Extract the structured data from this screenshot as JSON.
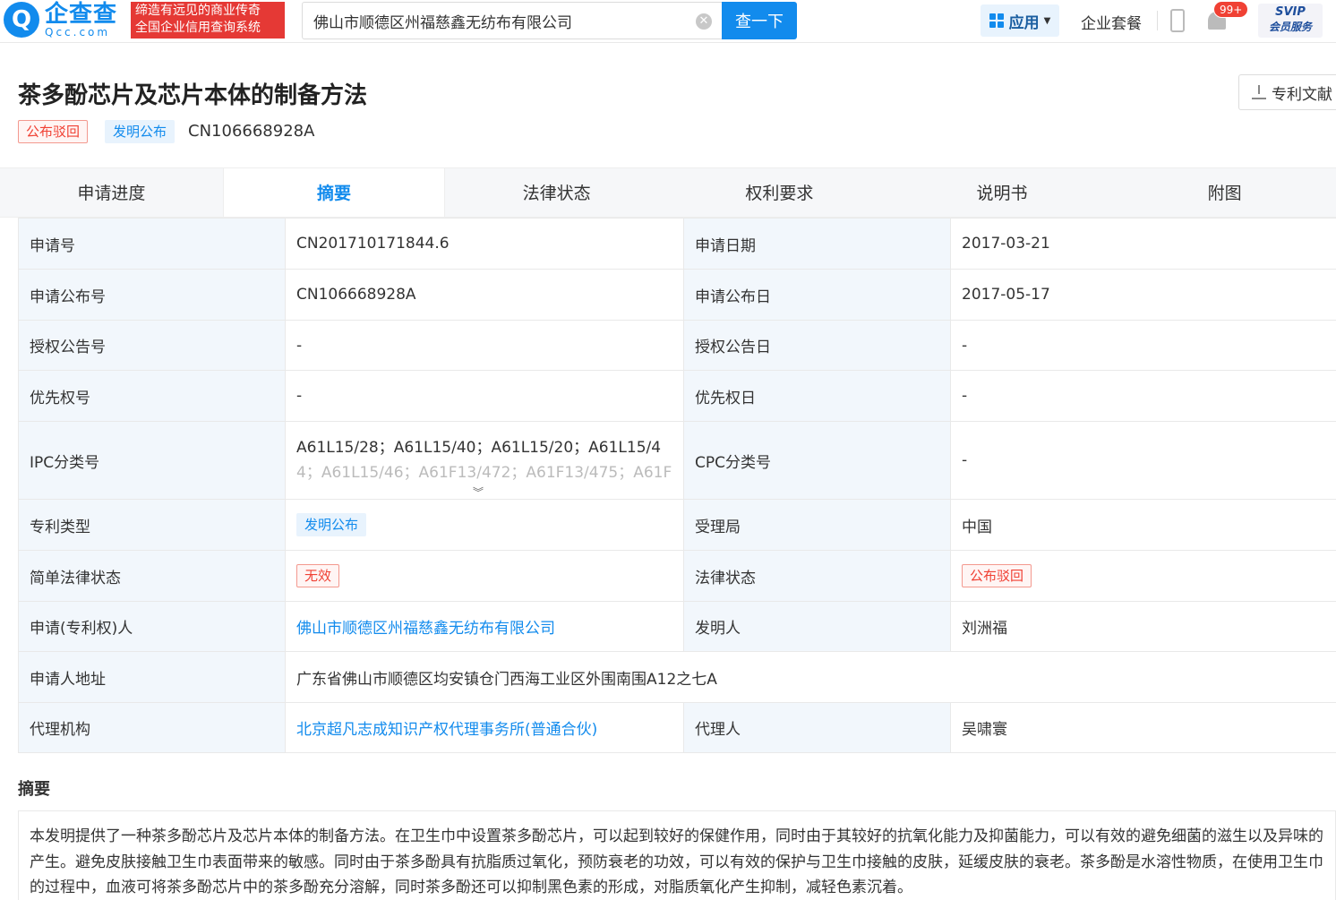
{
  "header": {
    "logo_mark": "Q",
    "logo_name": "企查查",
    "logo_domain": "Qcc.com",
    "slogan_line1": "缔造有远见的商业传奇",
    "slogan_line2": "全国企业信用查询系统",
    "search_value": "佛山市顺德区州福慈鑫无纺布有限公司",
    "search_button": "查一下",
    "apps_label": "应用",
    "package_label": "企业套餐",
    "notification_count": "99+",
    "svip_label": "SVIP",
    "svip_sub": "会员服务"
  },
  "patent": {
    "title": "茶多酚芯片及芯片本体的制备方法",
    "status_tag": "公布驳回",
    "type_tag": "发明公布",
    "number": "CN106668928A",
    "download_label": "专利文献"
  },
  "tabs": [
    "申请进度",
    "摘要",
    "法律状态",
    "权利要求",
    "说明书",
    "附图"
  ],
  "active_tab": "摘要",
  "details": {
    "app_no_label": "申请号",
    "app_no": "CN201710171844.6",
    "app_date_label": "申请日期",
    "app_date": "2017-03-21",
    "pub_no_label": "申请公布号",
    "pub_no": "CN106668928A",
    "pub_date_label": "申请公布日",
    "pub_date": "2017-05-17",
    "grant_no_label": "授权公告号",
    "grant_no": "-",
    "grant_date_label": "授权公告日",
    "grant_date": "-",
    "priority_no_label": "优先权号",
    "priority_no": "-",
    "priority_date_label": "优先权日",
    "priority_date": "-",
    "ipc_label": "IPC分类号",
    "ipc_line1": "A61L15/28；A61L15/40；A61L15/20；A61L15/4",
    "ipc_line2": "4；A61L15/46；A61F13/472；A61F13/475；A61F",
    "cpc_label": "CPC分类号",
    "cpc": "-",
    "patent_type_label": "专利类型",
    "patent_type": "发明公布",
    "office_label": "受理局",
    "office": "中国",
    "simple_status_label": "简单法律状态",
    "simple_status": "无效",
    "legal_status_label": "法律状态",
    "legal_status": "公布驳回",
    "applicant_label": "申请(专利权)人",
    "applicant": "佛山市顺德区州福慈鑫无纺布有限公司",
    "inventor_label": "发明人",
    "inventor": "刘洲福",
    "address_label": "申请人地址",
    "address": "广东省佛山市顺德区均安镇仓门西海工业区外围南围A12之七A",
    "agency_label": "代理机构",
    "agency": "北京超凡志成知识产权代理事务所(普通合伙)",
    "agent_label": "代理人",
    "agent": "吴啸寰"
  },
  "abstract": {
    "title": "摘要",
    "text": "本发明提供了一种茶多酚芯片及芯片本体的制备方法。在卫生巾中设置茶多酚芯片，可以起到较好的保健作用，同时由于其较好的抗氧化能力及抑菌能力，可以有效的避免细菌的滋生以及异味的产生。避免皮肤接触卫生巾表面带来的敏感。同时由于茶多酚具有抗脂质过氧化，预防衰老的功效，可以有效的保护与卫生巾接触的皮肤，延缓皮肤的衰老。茶多酚是水溶性物质，在使用卫生巾的过程中，血液可将茶多酚芯片中的茶多酚充分溶解，同时茶多酚还可以抑制黑色素的形成，对脂质氧化产生抑制，减轻色素沉着。"
  },
  "colors": {
    "accent": "#128bed",
    "danger": "#f04134",
    "label_bg": "#f2f7fc"
  }
}
